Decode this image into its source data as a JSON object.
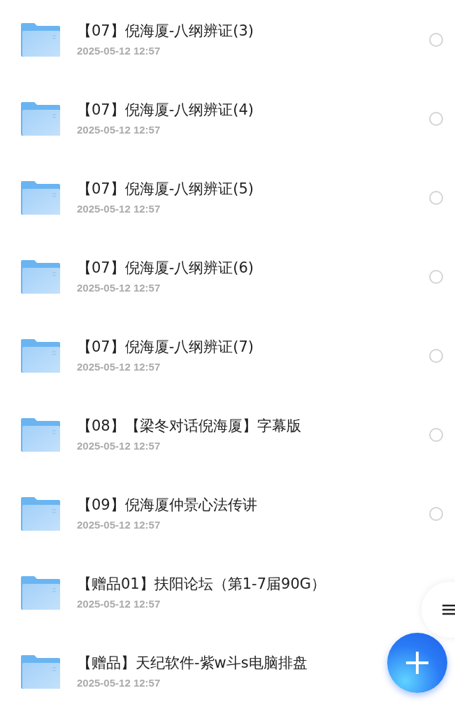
{
  "files": [
    {
      "name": "【07】倪海厦-八纲辨证(3)",
      "date": "2025-05-12 12:57",
      "selected": false
    },
    {
      "name": "【07】倪海厦-八纲辨证(4)",
      "date": "2025-05-12 12:57",
      "selected": false
    },
    {
      "name": "【07】倪海厦-八纲辨证(5)",
      "date": "2025-05-12 12:57",
      "selected": false
    },
    {
      "name": "【07】倪海厦-八纲辨证(6)",
      "date": "2025-05-12 12:57",
      "selected": false
    },
    {
      "name": "【07】倪海厦-八纲辨证(7)",
      "date": "2025-05-12 12:57",
      "selected": false
    },
    {
      "name": "【08】【梁冬对话倪海厦】字幕版",
      "date": "2025-05-12 12:57",
      "selected": false
    },
    {
      "name": "【09】倪海厦仲景心法传讲",
      "date": "2025-05-12 12:57",
      "selected": false
    },
    {
      "name": "【赠品01】扶阳论坛（第1-7届90G）",
      "date": "2025-05-12 12:57"
    },
    {
      "name": "【赠品】天纪软件-紫w斗s电脑排盘",
      "date": "2025-05-12 12:57"
    }
  ]
}
